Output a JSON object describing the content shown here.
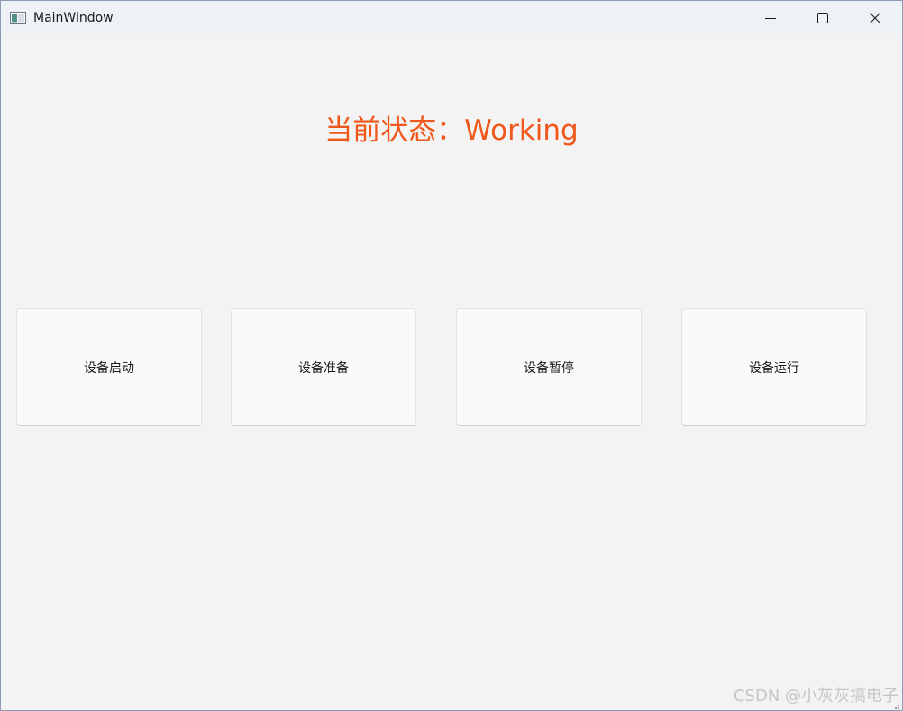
{
  "window": {
    "title": "MainWindow",
    "controls": {
      "minimize": "minimize",
      "maximize": "maximize",
      "close": "close"
    }
  },
  "status": {
    "text": "当前状态：Working",
    "color": "#f0571a"
  },
  "buttons": [
    {
      "label": "设备启动"
    },
    {
      "label": "设备准备"
    },
    {
      "label": "设备暂停"
    },
    {
      "label": "设备运行"
    }
  ],
  "watermark": "CSDN @小灰灰搞电子"
}
